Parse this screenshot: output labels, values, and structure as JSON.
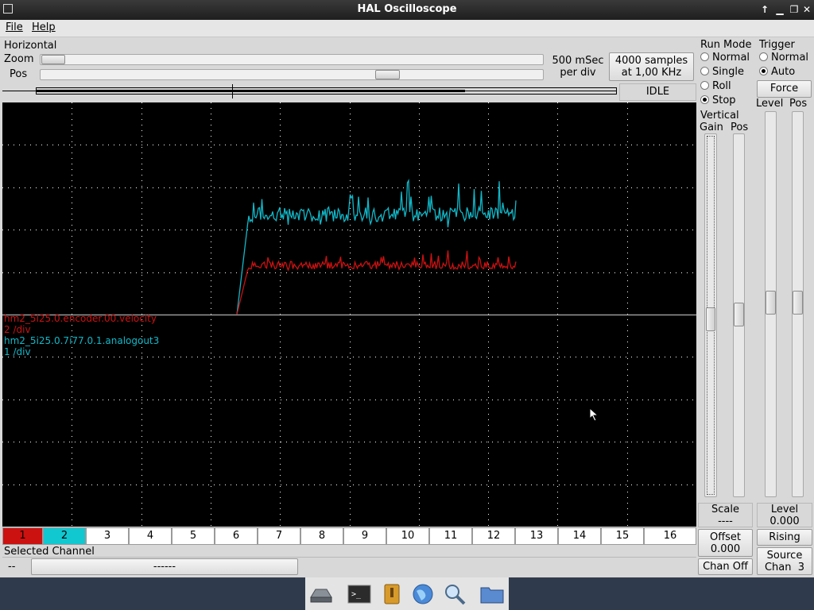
{
  "window": {
    "title": "HAL Oscilloscope"
  },
  "menu": {
    "file": "File",
    "help": "Help"
  },
  "horizontal": {
    "label": "Horizontal",
    "zoom_label": "Zoom",
    "pos_label": "Pos",
    "timebase_line1": "500 mSec",
    "timebase_line2": "per div",
    "samples_line1": "4000 samples",
    "samples_line2": "at 1,00 KHz",
    "status": "IDLE"
  },
  "run_mode": {
    "label": "Run Mode",
    "options": [
      "Normal",
      "Single",
      "Roll",
      "Stop"
    ],
    "selected": "Stop"
  },
  "trigger": {
    "label": "Trigger",
    "options": [
      "Normal",
      "Auto"
    ],
    "selected": "Auto",
    "force": "Force",
    "level_label": "Level",
    "pos_label": "Pos",
    "level_caption": "Level",
    "level_value": "0.000",
    "edge": "Rising",
    "source_line1": "Source",
    "source_line2": "Chan  3"
  },
  "vertical": {
    "label": "Vertical",
    "gain_label": "Gain",
    "pos_label": "Pos",
    "scale_label": "Scale",
    "scale_value": "----",
    "offset_label": "Offset",
    "offset_value": "0.000",
    "chan_off": "Chan Off"
  },
  "traces": [
    {
      "name": "hm2_5i25.0.encoder.00.velocity",
      "scale": "2 /div",
      "color": "#cc1111"
    },
    {
      "name": "hm2_5i25.0.7i77.0.1.analogout3",
      "scale": "1 /div",
      "color": "#11b8c8"
    }
  ],
  "channels": [
    "1",
    "2",
    "3",
    "4",
    "5",
    "6",
    "7",
    "8",
    "9",
    "10",
    "11",
    "12",
    "13",
    "14",
    "15",
    "16"
  ],
  "channel_colors": {
    "1": "#cc1111",
    "2": "#11c8d0"
  },
  "selected_channel": {
    "label": "Selected Channel",
    "value": "--",
    "name": "------"
  },
  "taskbar": {
    "icons": [
      "drive-icon",
      "terminal-icon",
      "archive-icon",
      "browser-icon",
      "search-icon",
      "folder-icon"
    ]
  }
}
